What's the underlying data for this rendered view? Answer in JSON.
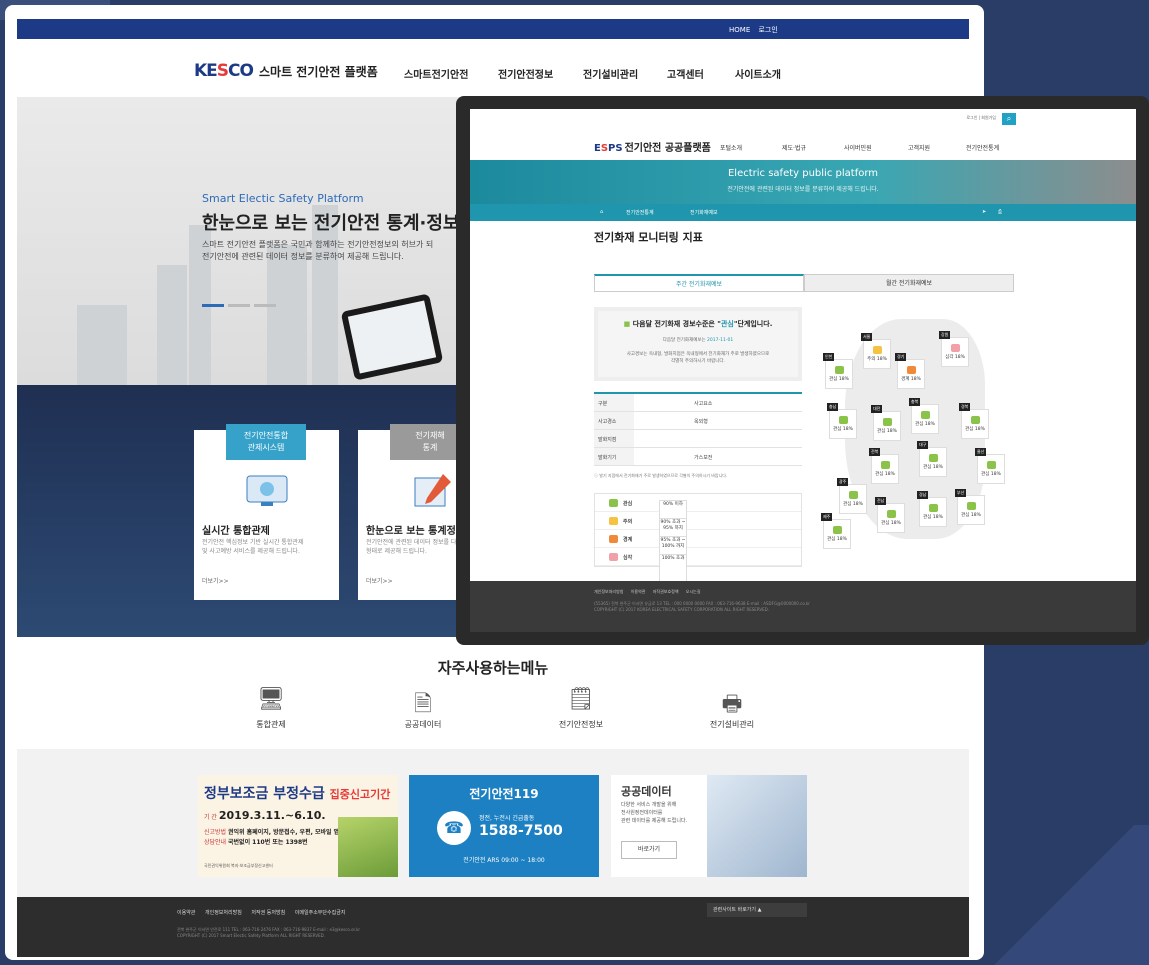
{
  "site": {
    "topbar": {
      "home": "HOME",
      "login": "로그인"
    },
    "logo": {
      "brand_a": "KE",
      "brand_b": "S",
      "brand_c": "CO",
      "title": "스마트 전기안전 플랫폼"
    },
    "gnb": [
      "스마트전기안전",
      "전기안전정보",
      "전기설비관리",
      "고객센터",
      "사이트소개"
    ],
    "hero": {
      "sub": "Smart Electic Safety Platform",
      "title": "한눈으로 보는 전기안전 통계·정보",
      "desc1": "스마트 전기안전 플랫폼은 국민과 함께하는 전기안전정보의 허브가 되",
      "desc2": "전기안전에 관련된 데이터 정보를 분류하여 제공해 드립니다."
    },
    "cards": [
      {
        "tag1": "전기안전통합",
        "tag2": "관제시스템",
        "title": "실시간 통합관제",
        "desc1": "전기안전 핵심정보 기반 실시간 통합관제",
        "desc2": "및 사고예방 서비스를 제공해 드립니다.",
        "more": "더보기>>"
      },
      {
        "tag1": "전기재해",
        "tag2": "통계",
        "title": "한눈으로 보는 통계정보",
        "desc1": "전기안전에 관련된 데이터 정보를 다",
        "desc2": "형태로 제공해 드립니다.",
        "more": "더보기>>"
      }
    ],
    "menus": {
      "title": "자주사용하는메뉴",
      "items": [
        "통합관제",
        "공공데이터",
        "전기안전정보",
        "전기설비관리"
      ]
    },
    "banner1": {
      "title": "정부보조금 부정수급",
      "title2": "집중신고기간",
      "period_label": "기  간",
      "period": "2019.3.11.~6.10.",
      "method_label": "신고방법",
      "method": "권익위 홈페이지, 방문접수, 우편, 모바일 앱",
      "consult_label": "상담안내",
      "consult": "국번없이 110번 또는 1398번",
      "gov": "국민권익위원회 복지·보조금부정신고센터"
    },
    "banner2": {
      "title": "전기안전119",
      "sub": "정전, 누전시 긴급출동",
      "number": "1588-7500",
      "ars": "전기안전 ARS 09:00 ~ 18:00"
    },
    "banner3": {
      "title": "공공데이터",
      "desc1": "다양한 서비스 개발을 위해",
      "desc2": "전사원정전데이터를",
      "desc3": "관련 데이터를 제공해 드립니다.",
      "button": "바로가기"
    },
    "footer": {
      "links": [
        "이용약관",
        "개인정보처리방침",
        "저작권 등저방침",
        "이메일주소무단수집금지"
      ],
      "related": "관련사이트 바로가기",
      "addr": "전북 완주군 이서면 안전로 111    TEL : 063-716-2476    FAX : 063-716-9837    E-mail : e3@kesco.or.kr",
      "copy": "COPYRIGHT (C) 2017 Smart Electic Safety Platform ALL RIGHT RESERVED."
    }
  },
  "overlay": {
    "top": {
      "login": "로그인",
      "join": "회원가입"
    },
    "logo": {
      "brand_a": "E",
      "brand_b": "S",
      "brand_c": "PS",
      "title": "전기안전 공공플랫폼"
    },
    "nav": [
      "포털소개",
      "제도·법규",
      "사이버민원",
      "고객지원",
      "전기안전통계"
    ],
    "banner": {
      "title": "Electric safety public platform",
      "sub": "전기안전에 관련된 데이터 정보를 분류하여 제공해 드립니다."
    },
    "breadcrumb": [
      "전기안전통계",
      "전기화재예보"
    ],
    "page_title": "전기화재 모니터링 지표",
    "tabs": [
      "주간 전기화재예보",
      "월간 전기화재예보"
    ],
    "alert": {
      "pre": "다음달 전기화재 경보수준은 \"",
      "level": "관심",
      "post": "\"단계입니다.",
      "date_label": "다음달 전기화재예보는 ",
      "date": "2017-11-01",
      "note1": "사고경보는 옥내형, 발화지점은 옥내형에서 전기화재가 주로 발생하였으므로",
      "note2": "각별히 주의하시기 바랍니다."
    },
    "table": {
      "header": [
        "구분",
        "사고요소"
      ],
      "rows": [
        [
          "사고경소",
          "옥외형"
        ],
        [
          "발화지점",
          ""
        ],
        [
          "발화기기",
          "가스보전"
        ]
      ]
    },
    "table_note": "ⓘ 발기 지점에서 전기화재가 주로 발생하였으므로 각별히 주의하시기 바랍니다.",
    "legend": [
      {
        "name": "관심",
        "range": "90% 이하",
        "color": "#8bc34a"
      },
      {
        "name": "주의",
        "range": "90% 초과 ~ 95% 까지",
        "color": "#f5c242"
      },
      {
        "name": "경계",
        "range": "95% 초과 ~ 100% 까지",
        "color": "#f08a3a"
      },
      {
        "name": "심각",
        "range": "100% 초과",
        "color": "#f2a0a8"
      }
    ],
    "regions": [
      {
        "name": "서울",
        "val": "주의 18%",
        "color": "#f5c242"
      },
      {
        "name": "강원",
        "val": "심각 18%",
        "color": "#f2a0a8"
      },
      {
        "name": "인천",
        "val": "관심 18%",
        "color": "#8bc34a"
      },
      {
        "name": "경기",
        "val": "경계 18%",
        "color": "#f08a3a"
      },
      {
        "name": "충북",
        "val": "관심 18%",
        "color": "#8bc34a"
      },
      {
        "name": "충남",
        "val": "관심 18%",
        "color": "#8bc34a"
      },
      {
        "name": "대전",
        "val": "관심 18%",
        "color": "#8bc34a"
      },
      {
        "name": "경북",
        "val": "관심 18%",
        "color": "#8bc34a"
      },
      {
        "name": "대구",
        "val": "관심 18%",
        "color": "#8bc34a"
      },
      {
        "name": "전북",
        "val": "관심 18%",
        "color": "#8bc34a"
      },
      {
        "name": "울산",
        "val": "관심 18%",
        "color": "#8bc34a"
      },
      {
        "name": "광주",
        "val": "관심 18%",
        "color": "#8bc34a"
      },
      {
        "name": "전남",
        "val": "관심 18%",
        "color": "#8bc34a"
      },
      {
        "name": "경남",
        "val": "관심 18%",
        "color": "#8bc34a"
      },
      {
        "name": "부산",
        "val": "관심 18%",
        "color": "#8bc34a"
      },
      {
        "name": "제주",
        "val": "관심 18%",
        "color": "#8bc34a"
      }
    ],
    "footer": {
      "links": [
        "개인정보처리방침",
        "이용약관",
        "저작권보호정책",
        "오시는길"
      ],
      "addr": "(55365) 전북 완주군 이서면 유금로 13    TEL : 000 0000 0000    FAX : 063-716-9638    E-mail : ASDFG@0000000.co.kr",
      "copy": "COPYRIGHT (C) 2017 KOREA ELECTRICAL SAFETY CORPORATION ALL RIGHT RESERVED."
    }
  }
}
